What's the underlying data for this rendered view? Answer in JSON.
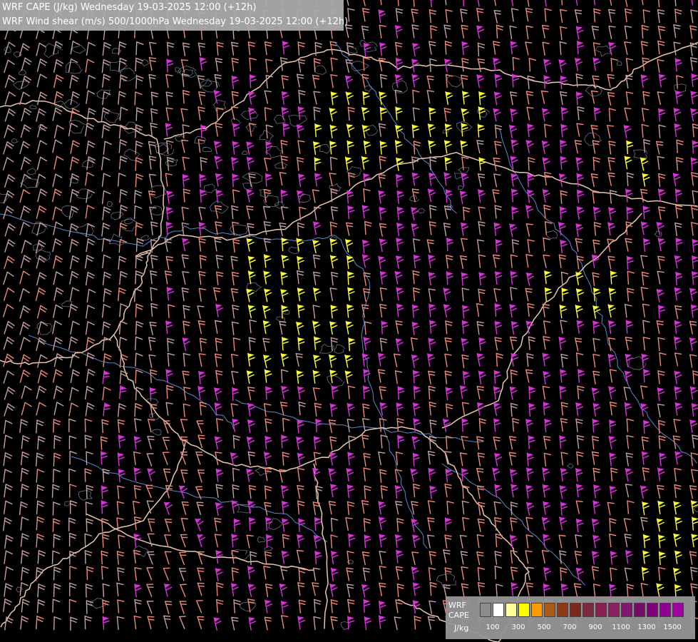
{
  "titles": {
    "line1": "WRF CAPE (J/kg) Wednesday 19-03-2025 12:00 (+12h)",
    "line2": "WRF Wind shear (m/s) 500/1000hPa Wednesday 19-03-2025 12:00 (+12h)"
  },
  "legend": {
    "label_line1": "WRF",
    "label_line2": "CAPE",
    "label_line3": "J/kg",
    "ticks": [
      "100",
      "300",
      "500",
      "700",
      "900",
      "1100",
      "1300",
      "1500"
    ],
    "colors": [
      "#8c8c8c",
      "#ffffff",
      "#ffff99",
      "#ffff00",
      "#ff9900",
      "#aa5a14",
      "#8e3a1a",
      "#7a2a1a",
      "#7a2a3c",
      "#8a2050",
      "#8a2060",
      "#801870",
      "#780a68",
      "#800080",
      "#900090",
      "#a000a0"
    ]
  },
  "barb_colors": {
    "weak": "#c8a0a0",
    "moderate": "#ee8a7a",
    "strong": "#e030e0",
    "very_strong": "#ffff30"
  },
  "line_colors": {
    "borders": "#e8c8b0",
    "rivers": "#5a88cc",
    "terrain": "#9aa0b8"
  }
}
